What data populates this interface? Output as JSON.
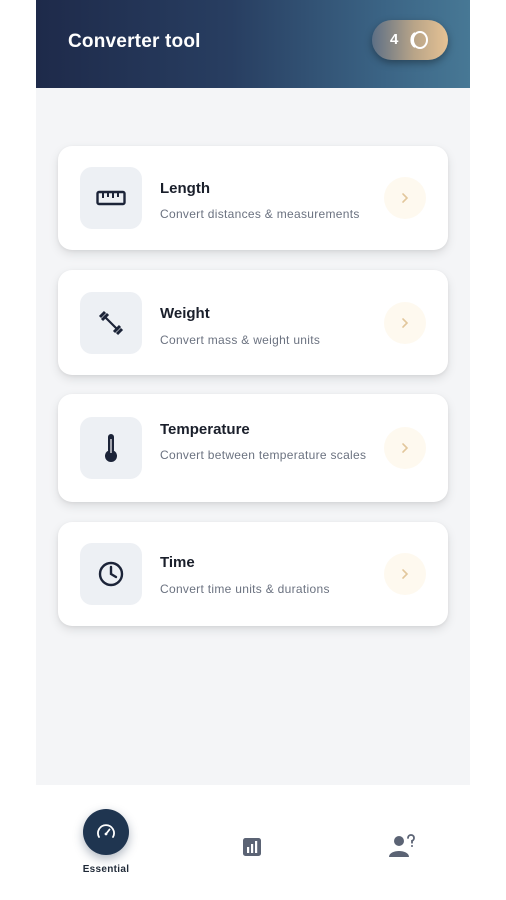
{
  "header": {
    "title": "Converter tool",
    "coin_count": "4",
    "coin_icon": "coin-stack-icon"
  },
  "cards": [
    {
      "title": "Length",
      "subtitle": "Convert distances & measurements",
      "icon": "ruler-icon"
    },
    {
      "title": "Weight",
      "subtitle": "Convert mass & weight units",
      "icon": "dumbbell-icon"
    },
    {
      "title": "Temperature",
      "subtitle": "Convert between temperature scales",
      "icon": "thermometer-icon"
    },
    {
      "title": "Time",
      "subtitle": "Convert time units & durations",
      "icon": "clock-icon"
    }
  ],
  "bottom_nav": {
    "items": [
      {
        "label": "Essential",
        "icon": "speedometer-icon",
        "active": true
      },
      {
        "label": "",
        "icon": "stats-icon",
        "active": false
      },
      {
        "label": "",
        "icon": "profile-icon",
        "active": false
      }
    ]
  },
  "colors": {
    "header_start": "#1e2a4a",
    "header_end": "#477895",
    "accent_navy": "#1f3550",
    "chevron": "#e2c79c",
    "background": "#f4f5f7"
  }
}
